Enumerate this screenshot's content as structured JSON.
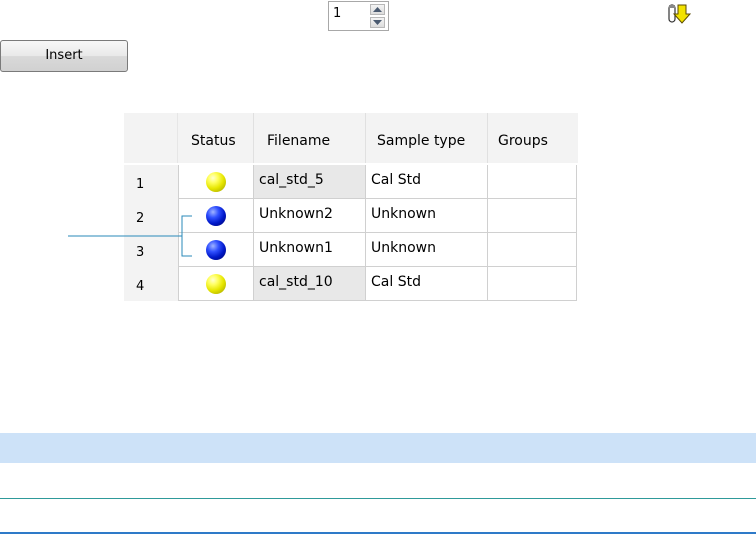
{
  "spinner": {
    "value": "1"
  },
  "insert_button": {
    "label": "Insert"
  },
  "table": {
    "headers": [
      "Status",
      "Filename",
      "Sample type",
      "Groups"
    ],
    "rows": [
      {
        "num": "1",
        "status": "yellow",
        "filename": "cal_std_5",
        "sample_type": "Cal Std",
        "groups": ""
      },
      {
        "num": "2",
        "status": "blue",
        "filename": "Unknown2",
        "sample_type": "Unknown",
        "groups": ""
      },
      {
        "num": "3",
        "status": "blue",
        "filename": "Unknown1",
        "sample_type": "Unknown",
        "groups": ""
      },
      {
        "num": "4",
        "status": "yellow",
        "filename": "cal_std_10",
        "sample_type": "Cal Std",
        "groups": ""
      }
    ]
  },
  "colors": {
    "status_yellow": "#e6e600",
    "status_blue": "#0018c8",
    "callout_line": "#2a8ab8",
    "band": "#cde2f8"
  }
}
